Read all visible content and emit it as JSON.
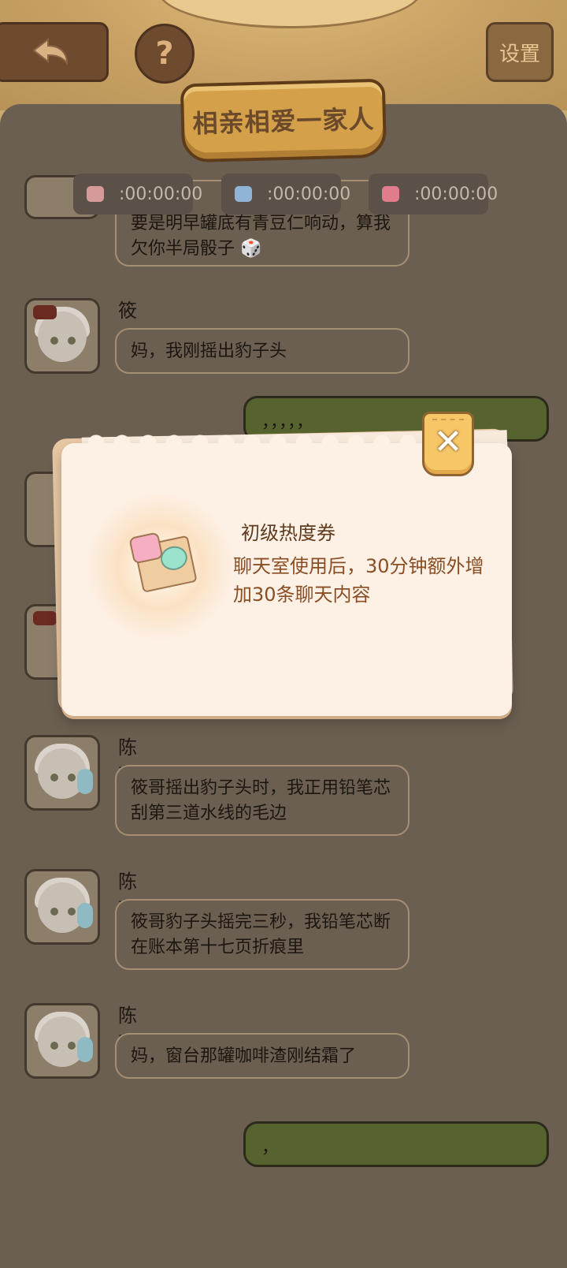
{
  "header": {
    "settings_label": "设置",
    "help_label": "?",
    "chat_title": "相亲相爱一家人"
  },
  "timers": [
    {
      "value": ":00:00:00",
      "color": "#d79a9a"
    },
    {
      "value": ":00:00:00",
      "color": "#8fb4d6"
    },
    {
      "value": ":00:00:00",
      "color": "#e07c8c"
    }
  ],
  "messages": [
    {
      "text": "要是明早罐底有青豆仁响动，算我欠你半局骰子 🎲"
    },
    {
      "sender": "筱",
      "text": "妈，我刚摇出豹子头"
    },
    {
      "self": true,
      "text": "，，，，，"
    },
    {
      "sender": "陈董",
      "text": "筱哥摇出豹子头时，我正用铅笔芯刮第三道水线的毛边"
    },
    {
      "sender": "陈董",
      "text": "筱哥豹子头摇完三秒，我铅笔芯断在账本第十七页折痕里"
    },
    {
      "sender": "陈董",
      "text": "妈，窗台那罐咖啡渣刚结霜了"
    },
    {
      "self": true,
      "text": "，"
    }
  ],
  "popup": {
    "item_name": "初级热度券",
    "item_desc": "聊天室使用后，30分钟额外增加30条聊天内容",
    "close_label": "✕"
  },
  "colors": {
    "panel_bg": "#6b5f51",
    "self_bubble": "#57632f",
    "title_plate": "#d4a04a",
    "popup_bg": "#fdf0e5"
  }
}
